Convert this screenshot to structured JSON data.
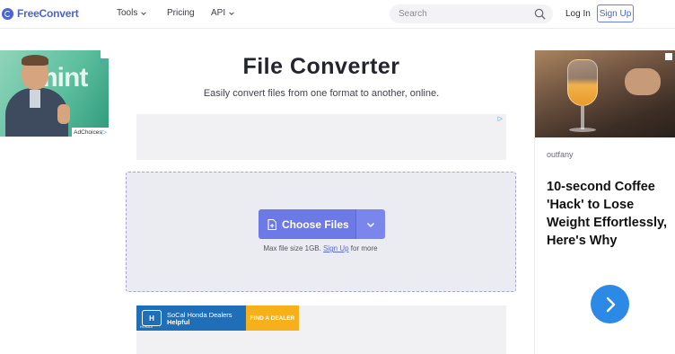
{
  "header": {
    "logo_text": "FreeConvert",
    "nav": [
      {
        "label": "Tools",
        "has_dropdown": true
      },
      {
        "label": "Pricing",
        "has_dropdown": false
      },
      {
        "label": "API",
        "has_dropdown": true
      }
    ],
    "search_placeholder": "Search",
    "login_label": "Log In",
    "signup_label": "Sign Up"
  },
  "ad_left": {
    "brand_text": "mint",
    "adchoices_label": "AdChoices"
  },
  "main": {
    "title": "File Converter",
    "subtitle": "Easily convert files from one format to another, online.",
    "choose_files_label": "Choose Files",
    "max_size_prefix": "Max file size 1GB.",
    "signup_link": "Sign Up",
    "max_size_suffix": "for more"
  },
  "ad_honda": {
    "logo_letter": "H",
    "logo_word": "HONDA",
    "line1": "SoCal Honda Dealers",
    "line2": "Helpful",
    "cta": "FIND A DEALER"
  },
  "ad_right": {
    "source": "outfany",
    "headline": "10-second Coffee 'Hack' to Lose Weight Effortlessly, Here's Why"
  },
  "colors": {
    "brand": "#4a63d8",
    "button": "#6d7ae6",
    "dropzone_bg": "#ebebf2",
    "dropzone_border": "#a9a3d8",
    "ad_arrow": "#2c89e6"
  }
}
